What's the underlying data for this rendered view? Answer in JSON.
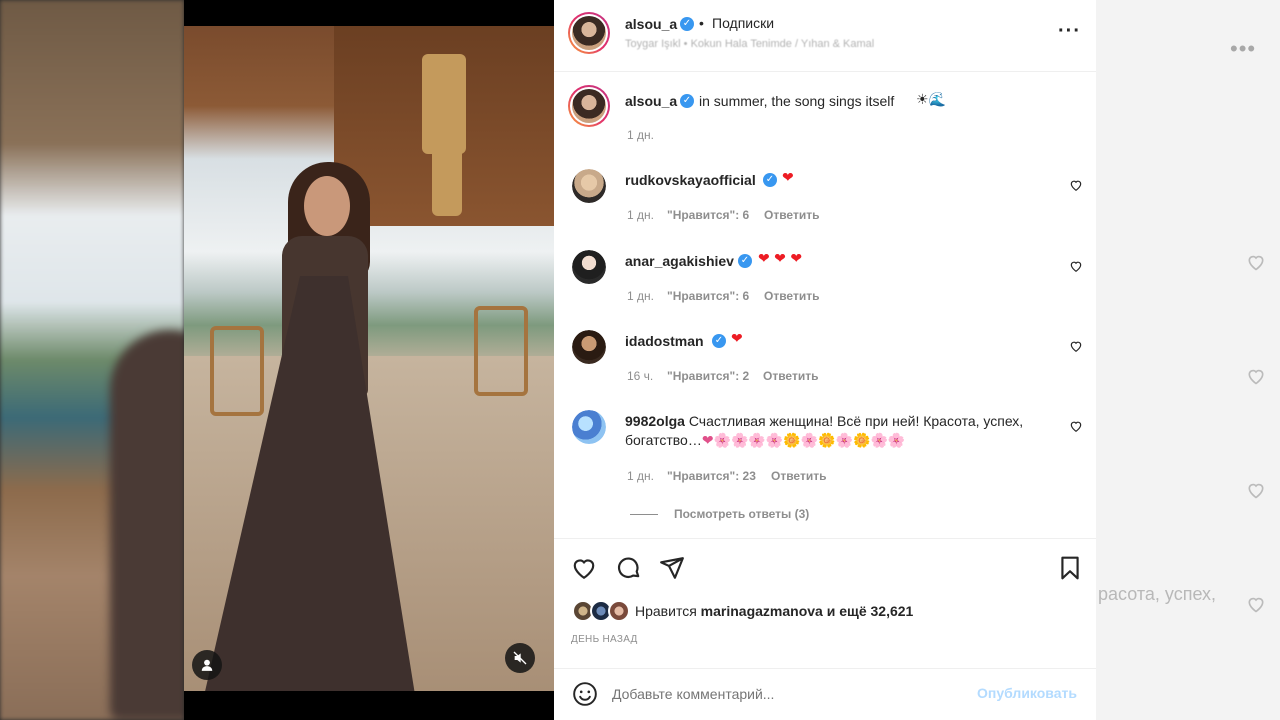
{
  "post": {
    "author": "alsou_a",
    "separator": "•",
    "follow_status": "Подписки",
    "location": "Toygar Işıkl • Kokun Hala Tenimde / Yıhan & Kamal",
    "caption": "in summer, the song sings itself",
    "caption_emoji": "☀🌊",
    "caption_time": "1 дн."
  },
  "comments": [
    {
      "user": "rudkovskaya_official",
      "display_user": "rudkovskayaofficial",
      "verified": true,
      "text": "❤",
      "time": "1 дн.",
      "likes": "\"Нравится\": 6",
      "reply": "Ответить"
    },
    {
      "user": "anar_agakishiev",
      "display_user": "anar_agakishiev",
      "verified": true,
      "text": "❤ ❤ ❤",
      "time": "1 дн.",
      "likes": "\"Нравится\": 6",
      "reply": "Ответить"
    },
    {
      "user": "idadostman",
      "display_user": "idadostman",
      "verified": true,
      "text": "❤",
      "time": "16 ч.",
      "likes": "\"Нравится\": 2",
      "reply": "Ответить"
    },
    {
      "user": "9982olga",
      "display_user": "9982olga",
      "verified": false,
      "text_line1": "Счастливая женщина! Всё при ней! Красота, успех,",
      "text_line2": "богатство…",
      "emoji_line": "❤🌸🌸🌸🌸🌼🌸🌼🌸🌼🌸🌸",
      "time": "1 дн.",
      "likes": "\"Нравится\": 23",
      "reply": "Ответить",
      "view_replies": "Посмотреть ответы (3)"
    }
  ],
  "likes": {
    "prefix": "Нравится",
    "user": "marinagazmanova",
    "suffix": "и ещё 32,621",
    "date": "ДЕНЬ НАЗАД"
  },
  "comment_box": {
    "placeholder": "Добавьте комментарий...",
    "publish": "Опубликовать"
  },
  "background": {
    "ghost_text": "расота, успех,"
  },
  "colors": {
    "verified": "#3897f0",
    "publish_disabled": "#b3dbff",
    "heart_red": "#ed1c24"
  }
}
